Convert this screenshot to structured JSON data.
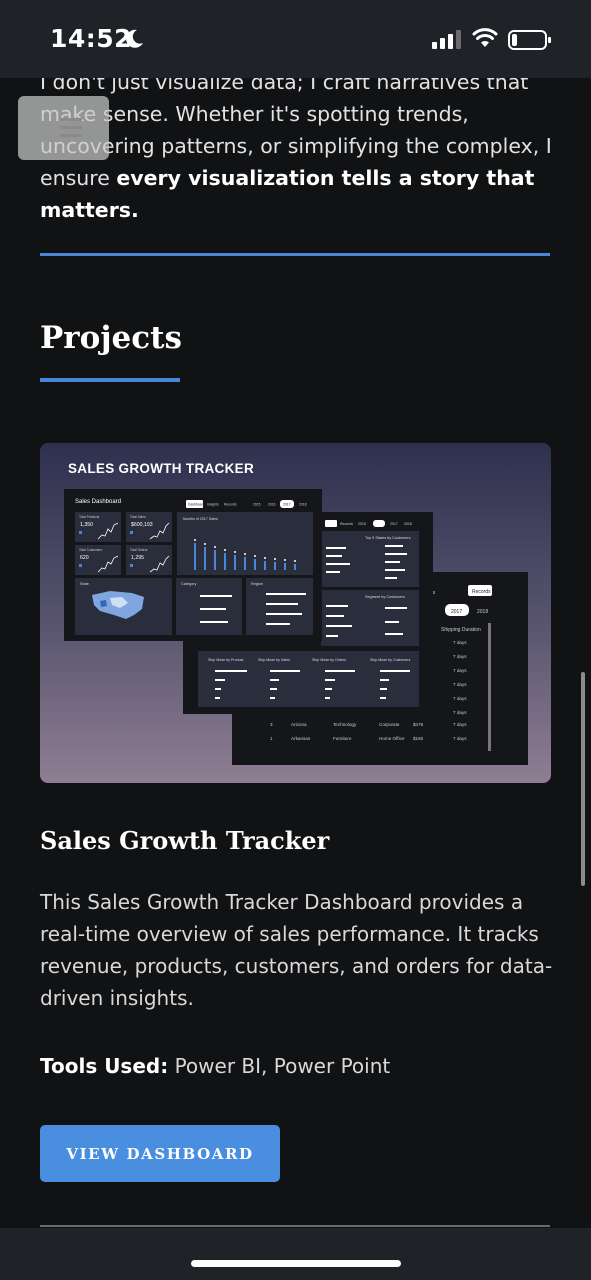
{
  "status_bar": {
    "time": "14:52"
  },
  "intro": {
    "line1": "I don't just visualize data; I craft narratives that make sense. Whether it's spotting trends, uncovering patterns, or simplifying the complex, I ensure ",
    "emphasis": "every visualization tells a story that matters."
  },
  "projects": {
    "heading": "Projects",
    "items": [
      {
        "thumbnail": {
          "heading": "SALES GROWTH TRACKER",
          "panel_title": "Sales Dashboard",
          "tabs": [
            "Dashboard",
            "Insights",
            "Records"
          ],
          "years": [
            "2015",
            "2016",
            "2017",
            "2018"
          ],
          "kpis": [
            {
              "label": "Total Products",
              "value": "1,350"
            },
            {
              "label": "Total Sales",
              "value": "$600,193"
            },
            {
              "label": "Total Customers",
              "value": "620"
            },
            {
              "label": "Total Orders",
              "value": "1,295"
            }
          ],
          "chart_label": "Months of 2017 Sales",
          "labels": [
            "State",
            "Category",
            "Region",
            "Ship Mode by Product",
            "Ship Mode by Sales",
            "Ship Mode by Orders",
            "Ship Mode by Customers",
            "Top 5 States by Customers",
            "Segment by Customers",
            "Shipping Duration"
          ],
          "rows": [
            {
              "id": "3",
              "state": "Arizona",
              "category": "Technology",
              "segment": "Corporate",
              "sales": "$476",
              "duration": "7 days"
            },
            {
              "id": "1",
              "state": "Arkansas",
              "category": "Furniture",
              "segment": "Home Office",
              "sales": "$160",
              "duration": "7 days"
            }
          ]
        },
        "title": "Sales Growth Tracker",
        "description": "This Sales Growth Tracker Dashboard provides a real-time overview of sales performance. It tracks revenue, products, customers, and orders for data-driven insights.",
        "tools_label": "Tools Used:",
        "tools_value": " Power BI, Power Point",
        "button_label": "VIEW DASHBOARD"
      }
    ]
  },
  "colors": {
    "accent": "#4a86d8",
    "button": "#4a8ee0",
    "background": "#111214"
  }
}
